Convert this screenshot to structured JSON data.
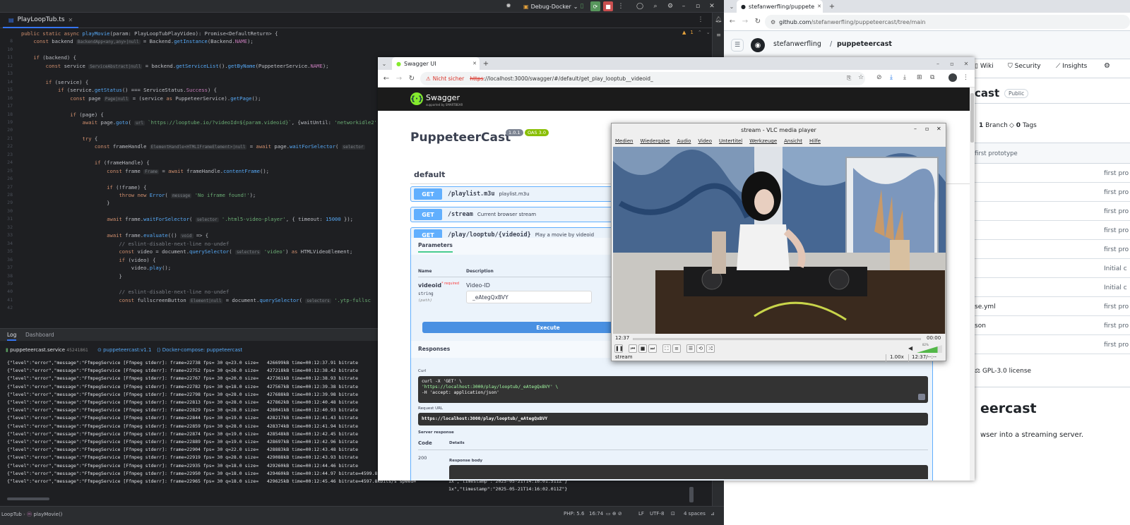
{
  "ide": {
    "run_config": "Debug-Docker",
    "file_tab": "PlayLoopTub.ts",
    "warnings": "1",
    "code_lines": [
      {
        "n": "",
        "html": "<span class='kw'>public static async</span> <span class='fn'>playMovie</span>(param: PlayLoopTubPlayVideo): Promise&lt;DefaultReturn&gt; {"
      },
      {
        "n": "8",
        "html": "    <span class='kw'>const</span> backend <span class='ih'>BackendApp&lt;any,any&gt;|null</span> = Backend.<span class='fn'>getInstance</span>(Backend.<span class='ty'>NAME</span>);"
      },
      {
        "n": "10",
        "html": ""
      },
      {
        "n": "11",
        "html": "    <span class='kw'>if</span> (backend) {"
      },
      {
        "n": "12",
        "html": "        <span class='kw'>const</span> service <span class='ih'>ServiceAbstract|null</span> = backend.<span class='fn'>getServiceList</span>().<span class='fn'>getByName</span>(PuppeteerService.<span class='ty'>NAME</span>);"
      },
      {
        "n": "13",
        "html": ""
      },
      {
        "n": "14",
        "html": "        <span class='kw'>if</span> (service) {"
      },
      {
        "n": "15",
        "html": "            <span class='kw'>if</span> (service.<span class='fn'>getStatus</span>() === ServiceStatus.<span class='ty'>Success</span>) {"
      },
      {
        "n": "16",
        "html": "                <span class='kw'>const</span> page <span class='ih'>Page|null</span> = (service <span class='kw'>as</span> PuppeteerService).<span class='fn'>getPage</span>();"
      },
      {
        "n": "17",
        "html": ""
      },
      {
        "n": "18",
        "html": "                <span class='kw'>if</span> (page) {"
      },
      {
        "n": "19",
        "html": "                    <span class='kw'>await</span> page.<span class='fn'>goto</span>( <span class='ih'>url</span> <span class='st'>`https://looptube.io/?videoId=${param.videoid}`</span>, {waitUntil: <span class='st'>'networkidle2'</span>"
      },
      {
        "n": "20",
        "html": ""
      },
      {
        "n": "21",
        "html": "                    <span class='kw'>try</span> {"
      },
      {
        "n": "22",
        "html": "                        <span class='kw'>const</span> frameHandle <span class='ih'>ElementHandle&lt;HTMLIFrameElement&gt;|null</span> = <span class='kw'>await</span> page.<span class='fn'>waitForSelector</span>( <span class='ih'>selector</span>"
      },
      {
        "n": "23",
        "html": ""
      },
      {
        "n": "24",
        "html": "                        <span class='kw'>if</span> (frameHandle) {"
      },
      {
        "n": "25",
        "html": "                            <span class='kw'>const</span> frame <span class='ih'>Frame</span> = <span class='kw'>await</span> frameHandle.<span class='fn'>contentFrame</span>();"
      },
      {
        "n": "26",
        "html": ""
      },
      {
        "n": "27",
        "html": "                            <span class='kw'>if</span> (!frame) {"
      },
      {
        "n": "28",
        "html": "                                <span class='kw'>throw new</span> <span class='fn'>Error</span>( <span class='ih'>message</span> <span class='st'>'No iframe found!'</span>);"
      },
      {
        "n": "29",
        "html": "                            }"
      },
      {
        "n": "30",
        "html": ""
      },
      {
        "n": "31",
        "html": "                            <span class='kw'>await</span> frame.<span class='fn'>waitForSelector</span>( <span class='ih'>selector</span> <span class='st'>'.html5-video-player'</span>, { timeout: <span class='fn'>15000</span> });"
      },
      {
        "n": "32",
        "html": ""
      },
      {
        "n": "33",
        "html": "                            <span class='kw'>await</span> frame.<span class='fn'>evaluate</span>(() <span class='ih'>void</span> =&gt; {"
      },
      {
        "n": "34",
        "html": "                                <span class='cm'>// eslint-disable-next-line no-undef</span>"
      },
      {
        "n": "35",
        "html": "                                <span class='kw'>const</span> video = document.<span class='fn'>querySelector</span>( <span class='ih'>selectors</span> <span class='st'>'video'</span>) <span class='kw'>as</span> HTMLVideoElement;"
      },
      {
        "n": "36",
        "html": "                                <span class='kw'>if</span> (video) {"
      },
      {
        "n": "37",
        "html": "                                    video.<span class='fn'>play</span>();"
      },
      {
        "n": "38",
        "html": "                                }"
      },
      {
        "n": "39",
        "html": ""
      },
      {
        "n": "40",
        "html": "                                <span class='cm'>// eslint-disable-next-line no-undef</span>"
      },
      {
        "n": "41",
        "html": "                                <span class='kw'>const</span> fullscreenButton <span class='ih'>Element|null</span> = document.<span class='fn'>querySelector</span>( <span class='ih'>selectors</span> <span class='st'>'.ytp-fullsc</span>"
      },
      {
        "n": "42",
        "html": ""
      }
    ],
    "log_tabs": [
      "Log",
      "Dashboard"
    ],
    "service_name": "puppeteercast.service",
    "service_id": "45241861",
    "service_tag": "puppeteercast:v1.1",
    "compose_label": "Docker-compose: puppeteercast",
    "log_lines": [
      "{\"level\":\"error\",\"message\":\"FfmpegService [Ffmpeg stderr]: frame=22738 fps= 30 q=23.0 size=   426699kB time=00:12:37.91 bitrate",
      "{\"level\":\"error\",\"message\":\"FfmpegService [Ffmpeg stderr]: frame=22752 fps= 30 q=26.0 size=   427218kB time=00:12:38.42 bitrate",
      "{\"level\":\"error\",\"message\":\"FfmpegService [Ffmpeg stderr]: frame=22767 fps= 30 q=20.0 size=   427361kB time=00:12:38.93 bitrate",
      "{\"level\":\"error\",\"message\":\"FfmpegService [Ffmpeg stderr]: frame=22782 fps= 30 q=18.0 size=   427567kB time=00:12:39.38 bitrate",
      "{\"level\":\"error\",\"message\":\"FfmpegService [Ffmpeg stderr]: frame=22798 fps= 30 q=28.0 size=   427688kB time=00:12:39.98 bitrate",
      "{\"level\":\"error\",\"message\":\"FfmpegService [Ffmpeg stderr]: frame=22813 fps= 30 q=28.0 size=   427862kB time=00:12:40.48 bitrate",
      "{\"level\":\"error\",\"message\":\"FfmpegService [Ffmpeg stderr]: frame=22829 fps= 30 q=28.0 size=   428041kB time=00:12:40.93 bitrate",
      "{\"level\":\"error\",\"message\":\"FfmpegService [Ffmpeg stderr]: frame=22844 fps= 30 q=19.0 size=   428217kB time=00:12:41.43 bitrate",
      "{\"level\":\"error\",\"message\":\"FfmpegService [Ffmpeg stderr]: frame=22859 fps= 30 q=28.0 size=   428374kB time=00:12:41.94 bitrate",
      "{\"level\":\"error\",\"message\":\"FfmpegService [Ffmpeg stderr]: frame=22874 fps= 30 q=19.0 size=   428548kB time=00:12:42.45 bitrate",
      "{\"level\":\"error\",\"message\":\"FfmpegService [Ffmpeg stderr]: frame=22889 fps= 30 q=19.0 size=   428697kB time=00:12:42.96 bitrate",
      "{\"level\":\"error\",\"message\":\"FfmpegService [Ffmpeg stderr]: frame=22904 fps= 30 q=22.0 size=   428883kB time=00:12:43.48 bitrate",
      "{\"level\":\"error\",\"message\":\"FfmpegService [Ffmpeg stderr]: frame=22919 fps= 30 q=28.0 size=   429088kB time=00:12:43.93 bitrate",
      "{\"level\":\"error\",\"message\":\"FfmpegService [Ffmpeg stderr]: frame=22935 fps= 30 q=18.0 size=   429260kB time=00:12:44.46 bitrate",
      "{\"level\":\"error\",\"message\":\"FfmpegService [Ffmpeg stderr]: frame=22950 fps= 30 q=18.0 size=   429460kB time=00:12:44.97 bitrate=4599.8kbits/s speed=",
      "{\"level\":\"error\",\"message\":\"FfmpegService [Ffmpeg stderr]: frame=22965 fps= 30 q=18.0 size=   429625kB time=00:12:45.46 bitrate=4597.8kbits/s speed="
    ],
    "log_overflow_lines": [
      "1x\",\"timestamp\":\"2025-05-21T14:16:01.511Z\"}",
      "1x\",\"timestamp\":\"2025-05-21T14:16:02.011Z\"}"
    ],
    "breadcrumb": [
      "LoopTub",
      "playMovie()"
    ],
    "status": {
      "php": "PHP: 5.6",
      "pos": "16:74",
      "eol": "LF",
      "enc": "UTF-8",
      "indent": "4 spaces"
    }
  },
  "github": {
    "tab_title": "stefanwerfling/puppete",
    "url_host": "github.com",
    "url_path": "/stefanwerfling/puppeteercast/tree/main",
    "owner": "stefanwerfling",
    "repo": "puppeteercast",
    "nav": [
      "Wiki",
      "Security",
      "Insights"
    ],
    "repo_title_partial": "cast",
    "visibility": "Public",
    "branches": "1 Branch",
    "branches_count": "1",
    "branches_label": "Branch",
    "tags_count": "0",
    "tags_label": "Tags",
    "commit_msg": "first prototype",
    "row_commits": [
      "first pro",
      "first pro",
      "first pro",
      "first pro",
      "first pro",
      "Initial c",
      "Initial c",
      "first pro",
      "first pro",
      "first pro"
    ],
    "row_names": [
      "",
      "",
      "",
      "",
      "",
      "",
      "",
      "se.yml",
      "son",
      ""
    ],
    "license": "GPL-3.0 license",
    "readme_title_partial": "eercast",
    "readme_text_partial": "wser into a streaming server."
  },
  "swagger": {
    "tab_title": "Swagger UI",
    "insecure_label": "Nicht sicher",
    "url_scheme": "https",
    "url_rest": "://localhost:3000/swagger/#/default/get_play_looptub__videoid_",
    "brand": "Swagger",
    "brand_sub": "supported by SMARTBEAR",
    "title": "PuppeteerCast",
    "version": "1.0.1",
    "oas": "OAS 3.0",
    "section": "default",
    "ops": [
      {
        "method": "GET",
        "path": "/playlist.m3u",
        "desc": "playlist.m3u"
      },
      {
        "method": "GET",
        "path": "/stream",
        "desc": "Current browser stream"
      },
      {
        "method": "GET",
        "path": "/play/looptub/{videoid}",
        "desc": "Play a movie by videoid"
      }
    ],
    "params_tab": "Parameters",
    "col_name": "Name",
    "col_desc": "Description",
    "param_name": "videoid",
    "param_required": "* required",
    "param_type": "string",
    "param_in": "(path)",
    "param_desc": "Video-ID",
    "param_value": "_eAtegQxBVY",
    "execute": "Execute",
    "responses": "Responses",
    "curl_label": "Curl",
    "curl_lines": [
      "curl -X 'GET' \\",
      "  'https://localhost:3000/play/looptub/_eAtegQxBVY' \\",
      "  -H 'accept: application/json'"
    ],
    "request_url_label": "Request URL",
    "request_url": "https://localhost:3000/play/looptub/_eAtegQxBVY",
    "server_response": "Server response",
    "code_col": "Code",
    "details_col": "Details",
    "code": "200",
    "response_body": "Response body"
  },
  "vlc": {
    "title": "stream - VLC media player",
    "menu": [
      "Medien",
      "Wiedergabe",
      "Audio",
      "Video",
      "Untertitel",
      "Werkzeuge",
      "Ansicht",
      "Hilfe"
    ],
    "elapsed": "12:37",
    "remaining": "00:00",
    "volume": "82%",
    "volume_level": 0.82,
    "stream_name": "stream",
    "speed": "1.00x",
    "time_total": "12:37/--:--"
  },
  "colors": {
    "get": "#61affe",
    "swagger_head": "#1b1b1b",
    "ide_bg": "#1e1f22",
    "oas": "#89bf04",
    "version": "#7d8492"
  }
}
